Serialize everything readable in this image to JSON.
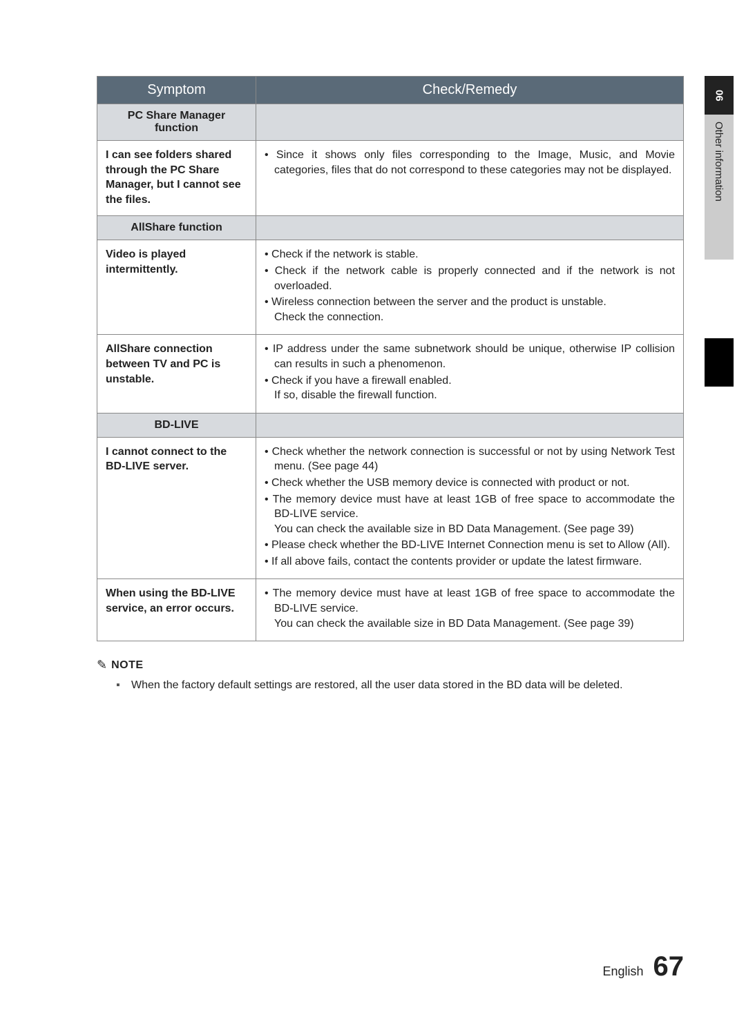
{
  "side": {
    "chapter_num": "06",
    "chapter_title": "Other information"
  },
  "table": {
    "headers": {
      "symptom": "Symptom",
      "remedy": "Check/Remedy"
    },
    "sections": [
      {
        "title": "PC Share Manager function",
        "rows": [
          {
            "symptom": "I can see folders shared through the PC Share Manager, but I cannot see the files.",
            "remedy_bullets": [
              "Since it shows only files corresponding to the Image, Music, and Movie categories, files that do not correspond to these categories may not be displayed."
            ]
          }
        ]
      },
      {
        "title": "AllShare function",
        "rows": [
          {
            "symptom": "Video is played intermittently.",
            "remedy_bullets": [
              "Check if the network is stable.",
              "Check if the network cable is properly connected and if the network is not overloaded.",
              "Wireless connection between the server and the product is unstable."
            ],
            "remedy_sublines": [
              "Check the connection."
            ]
          },
          {
            "symptom": "AllShare connection between TV and PC is unstable.",
            "remedy_bullets": [
              "IP address under the same subnetwork should be unique, otherwise IP collision can results in such a phenomenon.",
              "Check if you have a firewall enabled."
            ],
            "remedy_sublines": [
              "If so, disable the firewall function."
            ]
          }
        ]
      },
      {
        "title": "BD-LIVE",
        "rows": [
          {
            "symptom": "I cannot connect to the BD-LIVE server.",
            "remedy_bullets": [
              "Check whether the network connection is successful or not by using Network Test menu. (See page 44)",
              "Check whether the USB memory device is connected with product or not.",
              "The memory device must have at least 1GB of free space to accommodate the BD-LIVE service.",
              "You can check the available size in BD Data Management. (See page 39)",
              "Please check whether the BD-LIVE Internet Connection menu is set to Allow (All).",
              "If all above fails, contact the contents provider or update the latest firmware."
            ]
          },
          {
            "symptom": "When using the BD-LIVE service, an error occurs.",
            "remedy_bullets": [
              "The memory device must have at least 1GB of free space to accommodate the BD-LIVE service."
            ],
            "remedy_sublines": [
              "You can check the available size in BD Data Management. (See page 39)"
            ]
          }
        ]
      }
    ]
  },
  "note": {
    "label": "NOTE",
    "items": [
      "When the factory default settings are restored, all the user data stored in the BD data will be deleted."
    ]
  },
  "footer": {
    "language": "English",
    "page_number": "67"
  }
}
